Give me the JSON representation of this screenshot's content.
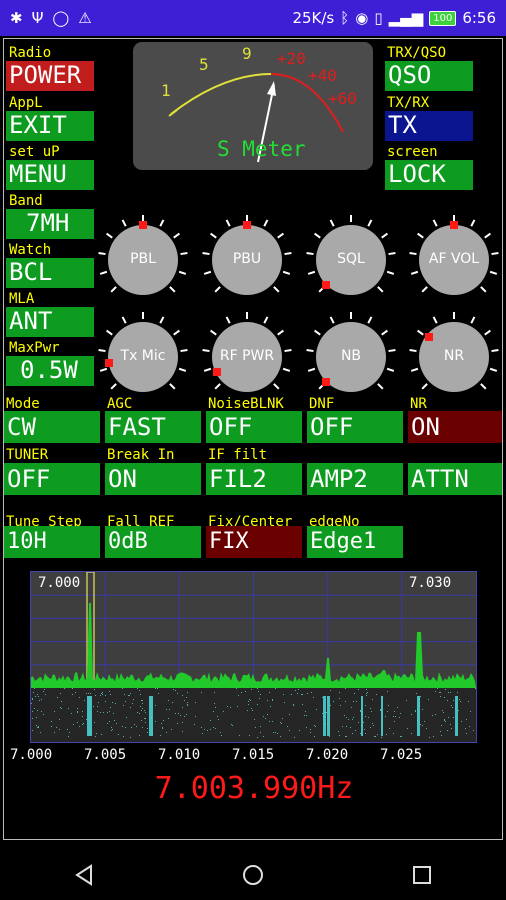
{
  "status": {
    "speed": "25K/s",
    "battery": "100",
    "time": "6:56"
  },
  "labels": {
    "radio": "Radio",
    "appl": "AppL",
    "setup": "set uP",
    "band": "Band",
    "watch": "Watch",
    "mla": "MLA",
    "maxpwr": "MaxPwr",
    "trxqso": "TRX/QSO",
    "txrx": "TX/RX",
    "screen": "screen"
  },
  "buttons": {
    "power": "POWER",
    "exit": "EXIT",
    "menu": "MENU",
    "band": "7MH",
    "bcl": "BCL",
    "ant": "ANT",
    "pwr": "0.5W",
    "qso": "QSO",
    "tx": "TX",
    "lock": "LOCK"
  },
  "smeter": {
    "title": "S Meter",
    "scale_left": [
      "1",
      "5",
      "9"
    ],
    "scale_right": [
      "+20",
      "+40",
      "+60"
    ]
  },
  "knobs": [
    "PBL",
    "PBU",
    "SQL",
    "AF VOL",
    "Tx Mic",
    "RF PWR",
    "NB",
    "NR"
  ],
  "settings_row1": {
    "labels": [
      "Mode",
      "AGC",
      "NoiseBLNK",
      "DNF",
      "NR"
    ],
    "values": [
      "CW",
      "FAST",
      "OFF",
      "OFF",
      "ON"
    ]
  },
  "settings_row2": {
    "labels": [
      "TUNER",
      "Break In",
      "IF filt",
      "",
      ""
    ],
    "values": [
      "OFF",
      "ON",
      "FIL2",
      "AMP2",
      "ATTN"
    ]
  },
  "settings_row3": {
    "labels": [
      "Tune Step",
      "Fall REF",
      "Fix/Center",
      "edgeNo"
    ],
    "values": [
      "10H",
      "0dB",
      "FIX",
      "Edge1"
    ]
  },
  "spectrum": {
    "start_label": "7.000",
    "end_label": "7.030",
    "ticks": [
      "7.000",
      "7.005",
      "7.010",
      "7.015",
      "7.020",
      "7.025"
    ]
  },
  "frequency": "7.003.990Hz",
  "colors": {
    "accent_green": "#0d9b20",
    "label_yellow": "#ffff00",
    "freq_red": "#ff1a1a",
    "status_bar": "#3f1fd6"
  },
  "icons": [
    "settings-icon",
    "usb-icon",
    "circle-icon",
    "warning-icon",
    "bluetooth-icon",
    "eye-icon",
    "vibrate-icon",
    "signal-icon",
    "battery-icon",
    "back-icon",
    "home-icon",
    "recents-icon"
  ]
}
